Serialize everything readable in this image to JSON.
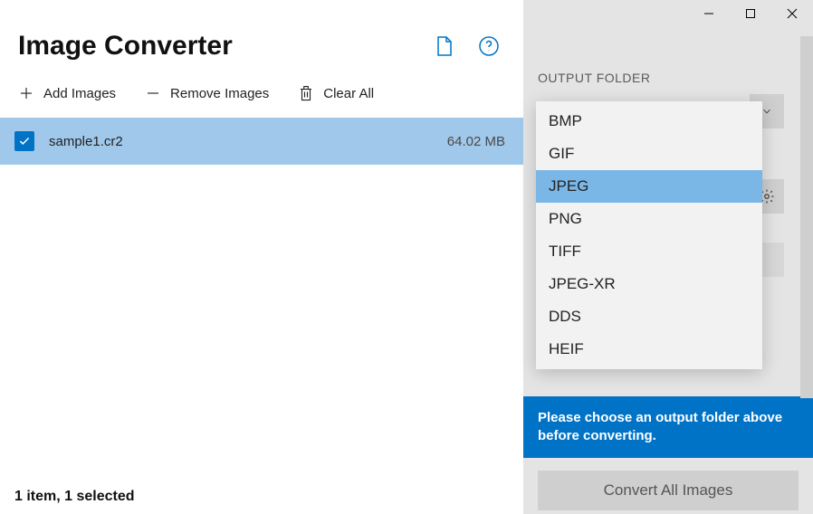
{
  "app": {
    "title": "Image Converter"
  },
  "toolbar": {
    "add_label": "Add Images",
    "remove_label": "Remove Images",
    "clear_label": "Clear All"
  },
  "file_list": [
    {
      "name": "sample1.cr2",
      "size": "64.02 MB",
      "selected": true
    }
  ],
  "status_bar": "1 item, 1 selected",
  "sidebar": {
    "output_folder_label": "OUTPUT FOLDER",
    "format_dropdown": {
      "selected": "JPEG",
      "options": [
        "BMP",
        "GIF",
        "JPEG",
        "PNG",
        "TIFF",
        "JPEG-XR",
        "DDS",
        "HEIF"
      ]
    },
    "banner": "Please choose an output folder above before converting.",
    "convert_button": "Convert All Images"
  }
}
